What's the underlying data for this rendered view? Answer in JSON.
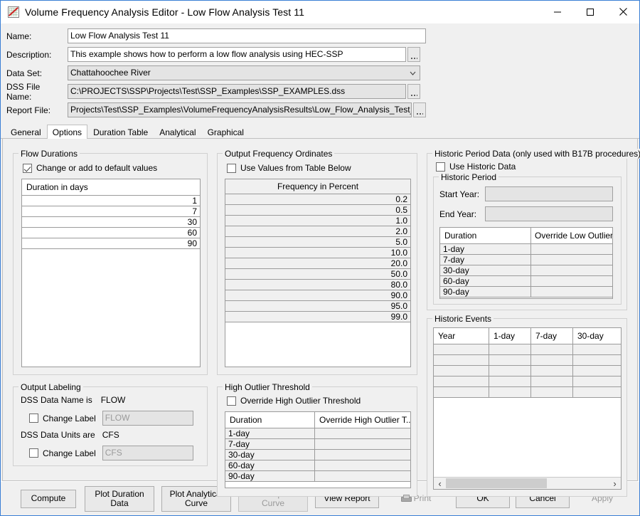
{
  "window": {
    "title": "Volume Frequency Analysis Editor - Low Flow Analysis Test 11",
    "icon": "chart-line-icon",
    "minimize_label": "–",
    "maximize_label": "☐",
    "close_label": "✕"
  },
  "form": {
    "name_label": "Name:",
    "name_value": "Low Flow Analysis Test 11",
    "description_label": "Description:",
    "description_value": "This example shows how to perform a low flow analysis using HEC-SSP",
    "dataset_label": "Data Set:",
    "dataset_value": "Chattahoochee River",
    "dss_file_label": "DSS File Name:",
    "dss_file_value": "C:\\PROJECTS\\SSP\\Projects\\Test\\SSP_Examples\\SSP_EXAMPLES.dss",
    "report_file_label": "Report File:",
    "report_file_value": "Projects\\Test\\SSP_Examples\\VolumeFrequencyAnalysisResults\\Low_Flow_Analysis_Test_11\\Low_",
    "browse_label": "..."
  },
  "tabs": [
    {
      "label": "General",
      "active": false
    },
    {
      "label": "Options",
      "active": true
    },
    {
      "label": "Duration Table",
      "active": false
    },
    {
      "label": "Analytical",
      "active": false
    },
    {
      "label": "Graphical",
      "active": false
    }
  ],
  "flow_durations": {
    "title": "Flow Durations",
    "checkbox_label": "Change or add to default values",
    "checked": true,
    "table_header": "Duration in days",
    "rows": [
      "1",
      "7",
      "30",
      "60",
      "90"
    ]
  },
  "output_labeling": {
    "title": "Output Labeling",
    "dss_name_label": "DSS Data Name is",
    "dss_name_value": "FLOW",
    "change_label_1": "Change Label",
    "change_label_1_checked": false,
    "name_field_value": "FLOW",
    "dss_units_label": "DSS Data Units are",
    "dss_units_value": "CFS",
    "change_label_2": "Change Label",
    "change_label_2_checked": false,
    "units_field_value": "CFS"
  },
  "output_frequency": {
    "title": "Output Frequency Ordinates",
    "checkbox_label": "Use Values from Table Below",
    "checked": false,
    "table_header": "Frequency in Percent",
    "rows": [
      "0.2",
      "0.5",
      "1.0",
      "2.0",
      "5.0",
      "10.0",
      "20.0",
      "50.0",
      "80.0",
      "90.0",
      "95.0",
      "99.0"
    ]
  },
  "high_outlier": {
    "title": "High Outlier Threshold",
    "checkbox_label": "Override High Outlier Threshold",
    "checked": false,
    "columns": [
      "Duration",
      "Override High Outlier T..."
    ],
    "rows": [
      [
        "1-day",
        ""
      ],
      [
        "7-day",
        ""
      ],
      [
        "30-day",
        ""
      ],
      [
        "60-day",
        ""
      ],
      [
        "90-day",
        ""
      ]
    ]
  },
  "historic_period": {
    "title": "Historic Period Data (only used with B17B procedures)",
    "checkbox_label": "Use Historic Data",
    "checked": false,
    "inner_title": "Historic Period",
    "start_year_label": "Start Year:",
    "start_year_value": "",
    "end_year_label": "End Year:",
    "end_year_value": "",
    "columns": [
      "Duration",
      "Override Low Outlier Thr..."
    ],
    "rows": [
      [
        "1-day",
        ""
      ],
      [
        "7-day",
        ""
      ],
      [
        "30-day",
        ""
      ],
      [
        "60-day",
        ""
      ],
      [
        "90-day",
        ""
      ]
    ]
  },
  "historic_events": {
    "title": "Historic Events",
    "columns": [
      "Year",
      "1-day",
      "7-day",
      "30-day"
    ],
    "rows": [
      [
        "",
        "",
        "",
        ""
      ],
      [
        "",
        "",
        "",
        ""
      ],
      [
        "",
        "",
        "",
        ""
      ],
      [
        "",
        "",
        "",
        ""
      ],
      [
        "",
        "",
        "",
        ""
      ]
    ],
    "scroll_left": "‹",
    "scroll_right": "›"
  },
  "buttons": {
    "compute": "Compute",
    "plot_duration_data": "Plot Duration\nData",
    "plot_analytical_curve": "Plot Analytical\nCurve",
    "plot_graphical_curve": "Plot Graphical\nCurve",
    "view_report": "View Report",
    "print": "Print",
    "ok": "OK",
    "cancel": "Cancel",
    "apply": "Apply"
  },
  "colors": {
    "window_border": "#3a7fd5",
    "panel_bg": "#f0f0f0",
    "field_bg": "#ffffff",
    "field_disabled_bg": "#e4e4e4",
    "table_row_bg": "#f0f0f0",
    "border": "#9b9b9b",
    "disabled_text": "#9a9a9a"
  }
}
